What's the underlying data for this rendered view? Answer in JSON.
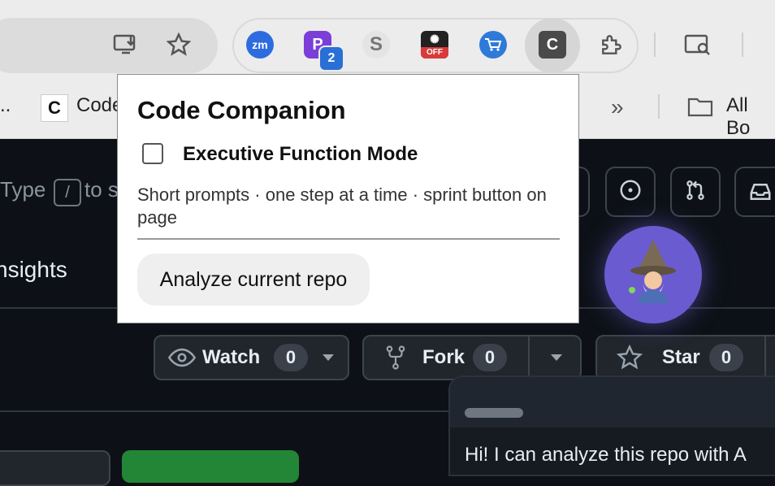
{
  "browser": {
    "extensions": [
      {
        "name": "zm",
        "label": "zm",
        "color": "#2d6cdf"
      },
      {
        "name": "P",
        "label": "P",
        "color": "#7b3fd8",
        "badge": "2"
      },
      {
        "name": "S",
        "label": "S",
        "color": "#e9e9e9"
      },
      {
        "name": "OFF",
        "label": "OFF",
        "color": "#d93a3a"
      },
      {
        "name": "cart",
        "label": "",
        "color": "#2e7ad9"
      },
      {
        "name": "C",
        "label": "C",
        "color": "#555555"
      }
    ],
    "bookmarks": {
      "partial_left": "..",
      "item1": "Code",
      "all_bookmarks": "All Bo"
    }
  },
  "page": {
    "search_fragment_left": "Type",
    "search_key": "/",
    "search_fragment_right": "to s",
    "nav_partial": "nsights",
    "watch": {
      "label": "Watch",
      "count": "0"
    },
    "fork": {
      "label": "Fork",
      "count": "0"
    },
    "star": {
      "label": "Star",
      "count": "0"
    },
    "chat_greeting": "Hi! I can analyze this repo with A"
  },
  "popup": {
    "title": "Code Companion",
    "mode_label": "Executive Function Mode",
    "mode_checked": false,
    "description": "Short prompts · one step at a time · sprint button on page",
    "analyze_button": "Analyze current repo"
  }
}
